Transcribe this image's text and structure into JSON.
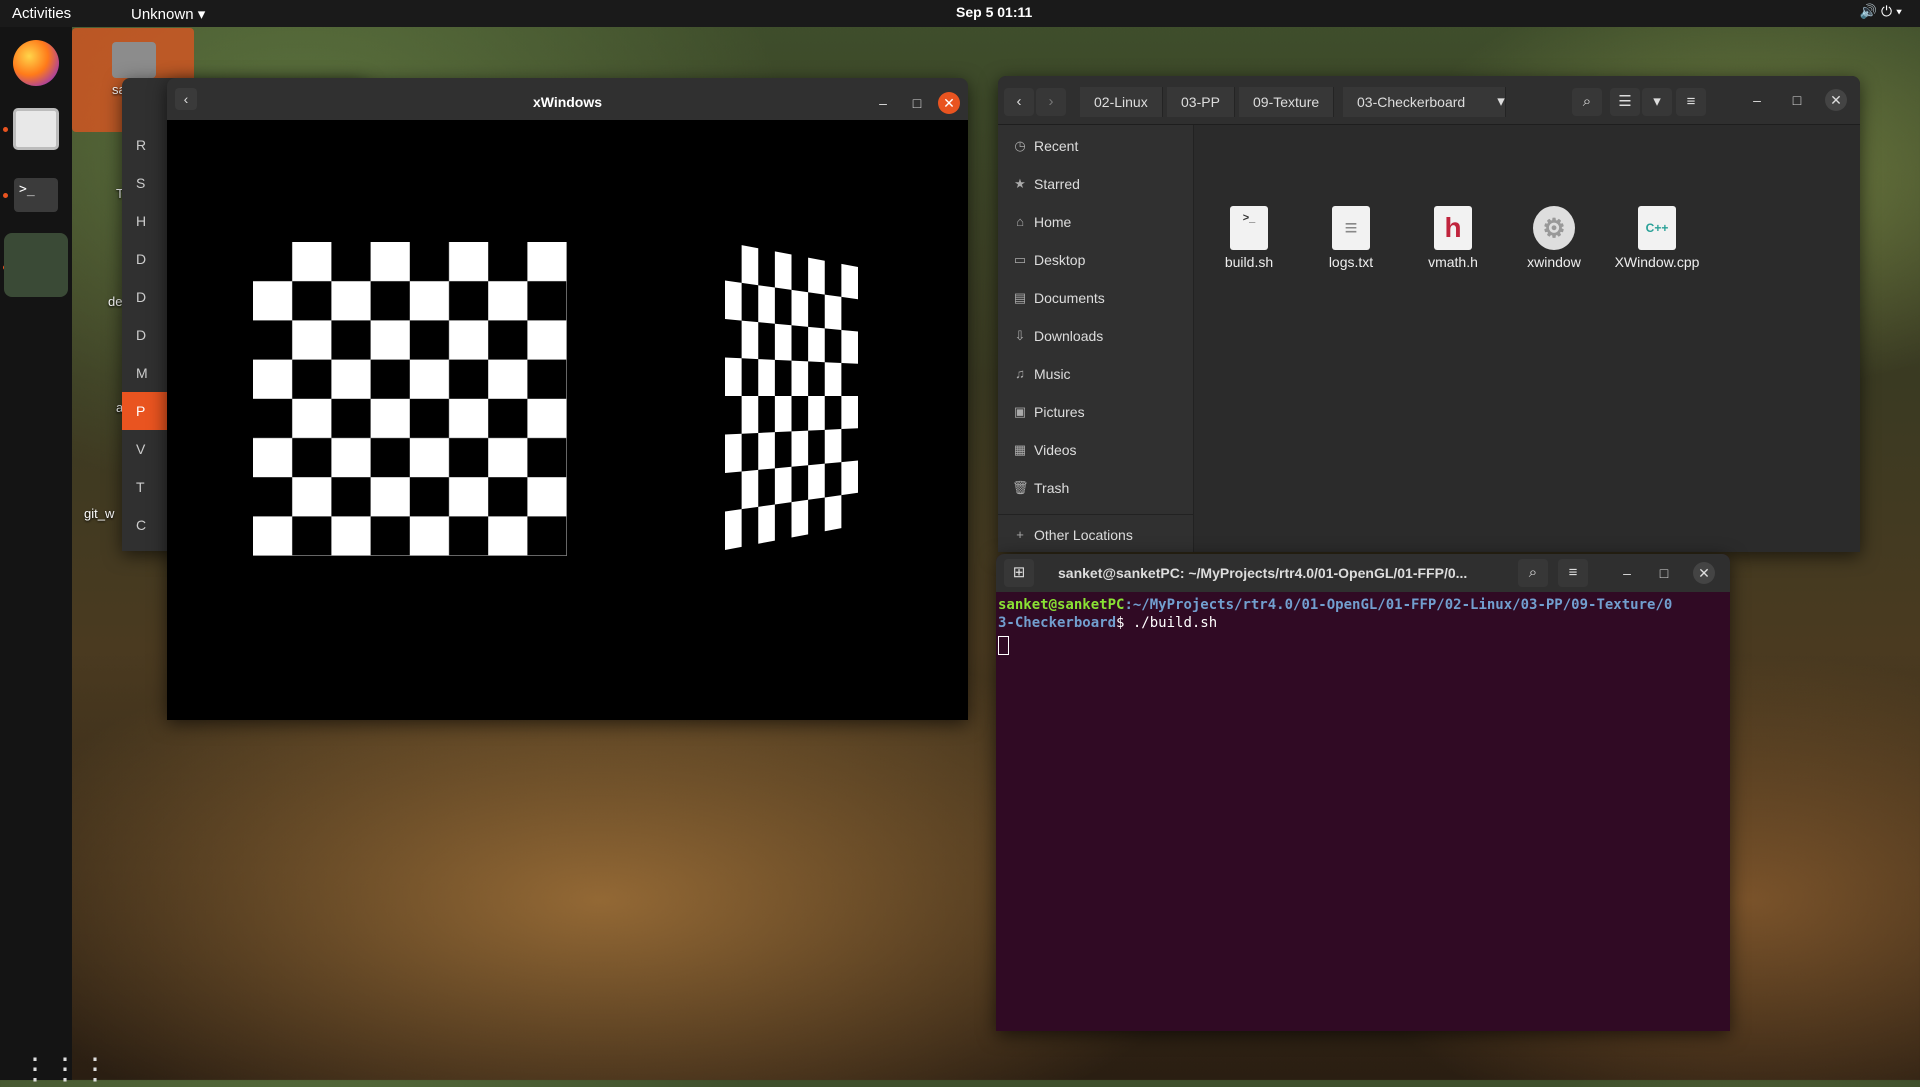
{
  "topbar": {
    "activities": "Activities",
    "app_menu": "Unknown",
    "clock": "Sep 5  01:11"
  },
  "desktop": {
    "icon_labels": [
      "sa",
      "T",
      "de",
      "a",
      "git_w"
    ]
  },
  "files_back": {
    "sidebar_items": [
      "R",
      "S",
      "H",
      "D",
      "D",
      "D",
      "M",
      "P",
      "V",
      "T",
      "C"
    ]
  },
  "xwin": {
    "title": "xWindows"
  },
  "file_manager": {
    "breadcrumbs": [
      "02-Linux",
      "03-PP",
      "09-Texture",
      "03-Checkerboard"
    ],
    "sidebar": [
      {
        "label": "Recent",
        "icon": "clock-icon"
      },
      {
        "label": "Starred",
        "icon": "star-icon"
      },
      {
        "label": "Home",
        "icon": "home-icon"
      },
      {
        "label": "Desktop",
        "icon": "desktop-icon"
      },
      {
        "label": "Documents",
        "icon": "documents-icon"
      },
      {
        "label": "Downloads",
        "icon": "download-icon"
      },
      {
        "label": "Music",
        "icon": "music-icon"
      },
      {
        "label": "Pictures",
        "icon": "pictures-icon"
      },
      {
        "label": "Videos",
        "icon": "videos-icon"
      },
      {
        "label": "Trash",
        "icon": "trash-icon"
      },
      {
        "label": "Other Locations",
        "icon": "plus-icon"
      }
    ],
    "files": [
      {
        "name": "build.sh",
        "glyph": ">_",
        "color": "#333333"
      },
      {
        "name": "logs.txt",
        "glyph": "≡",
        "color": "#888888"
      },
      {
        "name": "vmath.h",
        "glyph": "h",
        "color": "#c0243d"
      },
      {
        "name": "xwindow",
        "glyph": "⚙",
        "color": "#999999"
      },
      {
        "name": "XWindow.cpp",
        "glyph": "C++",
        "color": "#2aa198"
      }
    ]
  },
  "terminal": {
    "title": "sanket@sanketPC: ~/MyProjects/rtr4.0/01-OpenGL/01-FFP/0...",
    "user_host": "sanket@sanketPC",
    "path_line1": ":~/MyProjects/rtr4.0/01-OpenGL/01-FFP/02-Linux/03-PP/09-Texture/0",
    "path_line2": "3-Checkerboard",
    "prompt_cmd": "$ ./build.sh"
  }
}
